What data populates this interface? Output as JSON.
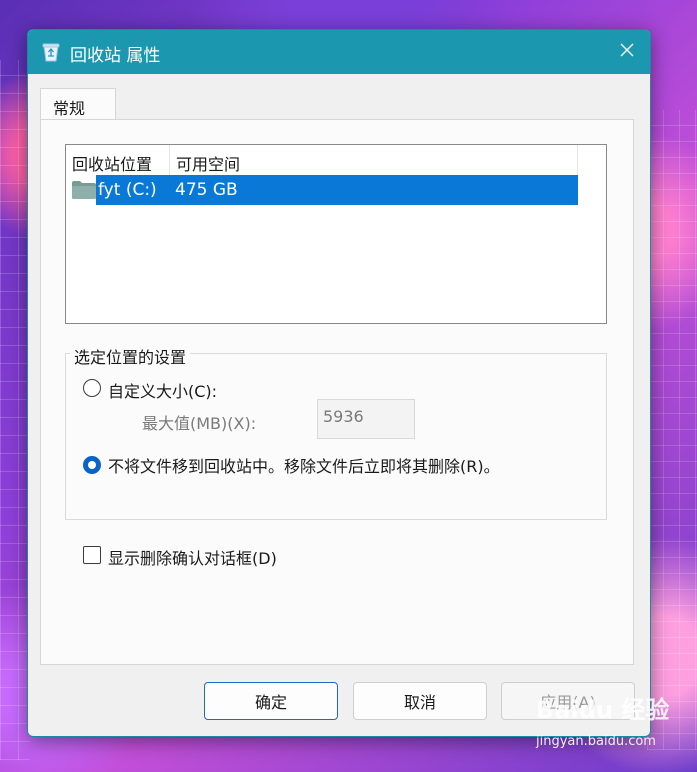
{
  "window": {
    "title": "回收站 属性",
    "close_icon": "close-icon",
    "app_icon": "recycle-bin-icon"
  },
  "tabs": [
    {
      "label": "常规",
      "selected": true
    }
  ],
  "location_list": {
    "columns": [
      "回收站位置",
      "可用空间"
    ],
    "rows": [
      {
        "icon": "folder-icon",
        "location": "fyt (C:)",
        "free_space": "475 GB",
        "selected": true
      }
    ]
  },
  "settings_group": {
    "legend": "选定位置的设置",
    "custom_size": {
      "label": "自定义大小(C):",
      "checked": false
    },
    "max_size": {
      "label": "最大值(MB)(X):",
      "value": "5936",
      "enabled": false
    },
    "no_recycle": {
      "label": "不将文件移到回收站中。移除文件后立即将其删除(R)。",
      "checked": true
    }
  },
  "confirm_dialog": {
    "label": "显示删除确认对话框(D)",
    "checked": false
  },
  "buttons": {
    "ok": "确定",
    "cancel": "取消",
    "apply": "应用(A)"
  },
  "watermark": {
    "logo": "Baidu 经验",
    "url": "jingyan.baidu.com"
  },
  "colors": {
    "titlebar": "#1b97b0",
    "selection": "#0a78d7",
    "radio_checked": "#0a64c8"
  }
}
